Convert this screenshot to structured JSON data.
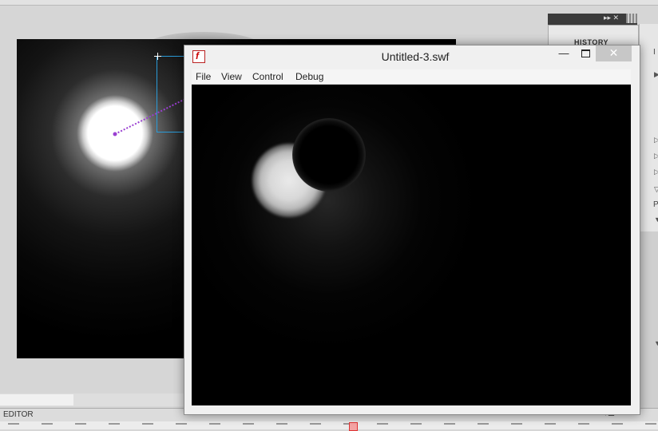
{
  "ide": {
    "panel_label": "HISTORY",
    "bottom_bar_label": "EDITOR",
    "bottom_bar_menu": "▾☰",
    "right_col_letters": [
      "I",
      "P"
    ],
    "panel_strip_buttons": "▸▸ ✕"
  },
  "player_window": {
    "title": "Untitled-3.swf",
    "minimize_glyph": "—",
    "close_glyph": "✕",
    "icon_glyph": "f",
    "menu": [
      "File",
      "View",
      "Control",
      "Debug"
    ]
  },
  "colors": {
    "motion_path": "#9a3fd1",
    "selection_box": "#2a9bd8",
    "close_button": "#c7c7c7",
    "playhead": "#f4a3a3"
  }
}
